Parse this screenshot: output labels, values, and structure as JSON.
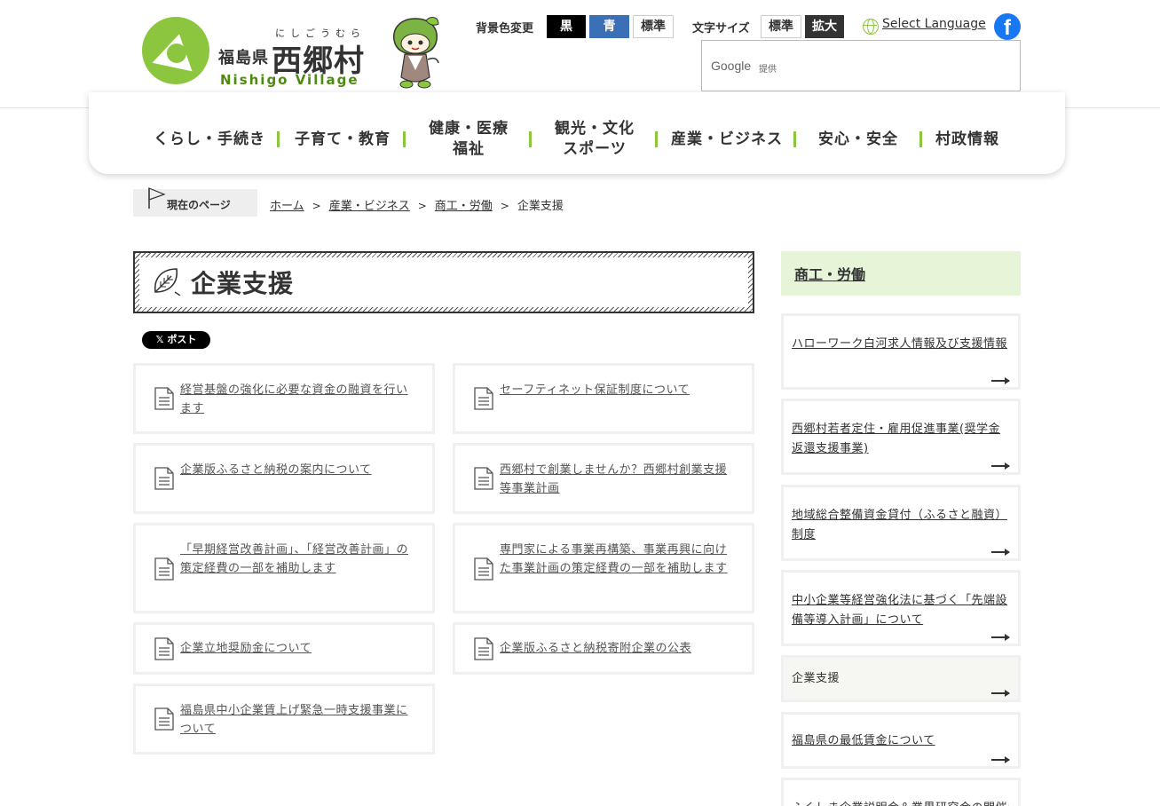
{
  "header": {
    "logo": {
      "prefecture": "福島県",
      "ruby": "にしごうむら",
      "village": "西郷村",
      "roman": "Nishigo Village"
    },
    "bg_color": {
      "label": "背景色変更",
      "options": [
        "黒",
        "青",
        "標準"
      ]
    },
    "font_size": {
      "label": "文字サイズ",
      "options": [
        "標準",
        "拡大"
      ]
    },
    "language": {
      "icon": "globe-icon",
      "label": "Select Language"
    },
    "facebook": {
      "icon": "facebook-icon",
      "glyph": "f"
    },
    "search": {
      "google_label": "Google",
      "provided": "提供"
    }
  },
  "nav": [
    {
      "label": "くらし・手続き"
    },
    {
      "label": "子育て・教育"
    },
    {
      "label": "健康・医療\n福祉"
    },
    {
      "label": "観光・文化\nスポーツ"
    },
    {
      "label": "産業・ビジネス"
    },
    {
      "label": "安心・安全"
    },
    {
      "label": "村政情報"
    }
  ],
  "breadcrumb": {
    "current_label": "現在のページ",
    "items": [
      "ホーム",
      "産業・ビジネス",
      "商工・労働"
    ],
    "current": "企業支援"
  },
  "page": {
    "title": "企業支援",
    "x_post": "𝕏 ポスト"
  },
  "cards": [
    {
      "label": "経営基盤の強化に必要な資金の融資を行います"
    },
    {
      "label": "セーフティネット保証制度について"
    },
    {
      "label": "企業版ふるさと納税の案内について"
    },
    {
      "label": "西郷村で創業しませんか？西郷村創業支援等事業計画"
    },
    {
      "label": "「早期経営改善計画」、「経営改善計画」の策定経費の一部を補助します"
    },
    {
      "label": "専門家による事業再構築、事業再興に向けた事業計画の策定経費の一部を補助します"
    },
    {
      "label": "企業立地奨励金について"
    },
    {
      "label": "企業版ふるさと納税寄附企業の公表"
    },
    {
      "label": "福島県中小企業賃上げ緊急一時支援事業について"
    }
  ],
  "sidebar": {
    "heading": "商工・労働",
    "items": [
      {
        "label": "ハローワーク白河求人情報及び支援情報"
      },
      {
        "label": "西郷村若者定住・雇用促進事業(奨学金返還支援事業)"
      },
      {
        "label": "地域総合整備資金貸付（ふるさと融資）制度"
      },
      {
        "label": "中小企業等経営強化法に基づく「先端設備等導入計画」について"
      },
      {
        "label": "企業支援"
      },
      {
        "label": "福島県の最低賃金について"
      },
      {
        "label": "ふくしま企業説明会＆業界研究会の開催について"
      }
    ]
  },
  "colors": {
    "brand_green": "#8cc63f",
    "sidebar_head_bg": "#e6f4d8",
    "bg_black_btn": "#000000",
    "bg_blue_btn": "#3b6fb6",
    "font_large_active": "#333333",
    "facebook": "#1877f2"
  }
}
